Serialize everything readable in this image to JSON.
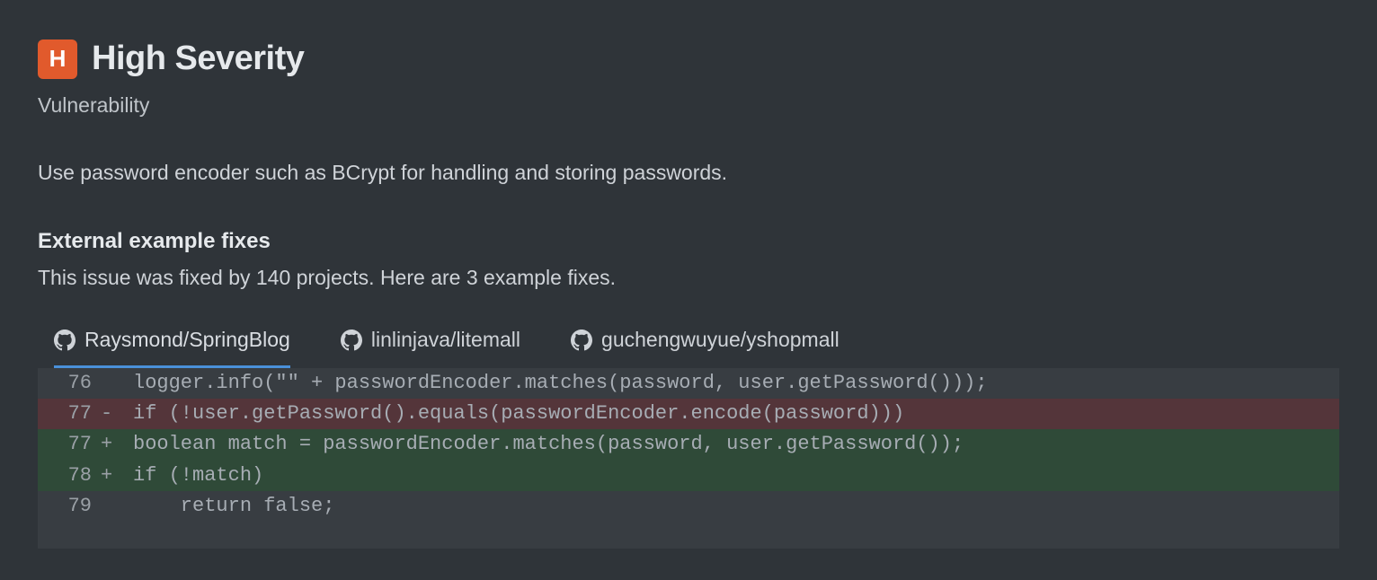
{
  "severity": {
    "badge_letter": "H",
    "title": "High Severity",
    "subtitle": "Vulnerability"
  },
  "description": "Use password encoder such as BCrypt for handling and storing passwords.",
  "fixes": {
    "heading": "External example fixes",
    "subtext": "This issue was fixed by 140 projects. Here are 3 example fixes."
  },
  "tabs": [
    {
      "label": "Raysmond/SpringBlog",
      "active": true
    },
    {
      "label": "linlinjava/litemall",
      "active": false
    },
    {
      "label": "guchengwuyue/yshopmall",
      "active": false
    }
  ],
  "code_lines": [
    {
      "num": "76",
      "marker": " ",
      "kind": "context",
      "text": "logger.info(\"\" + passwordEncoder.matches(password, user.getPassword()));"
    },
    {
      "num": "77",
      "marker": "-",
      "kind": "removed",
      "text": "if (!user.getPassword().equals(passwordEncoder.encode(password)))"
    },
    {
      "num": "77",
      "marker": "+",
      "kind": "added",
      "text": "boolean match = passwordEncoder.matches(password, user.getPassword());"
    },
    {
      "num": "78",
      "marker": "+",
      "kind": "added",
      "text": "if (!match)"
    },
    {
      "num": "79",
      "marker": " ",
      "kind": "context",
      "text": "    return false;"
    }
  ]
}
